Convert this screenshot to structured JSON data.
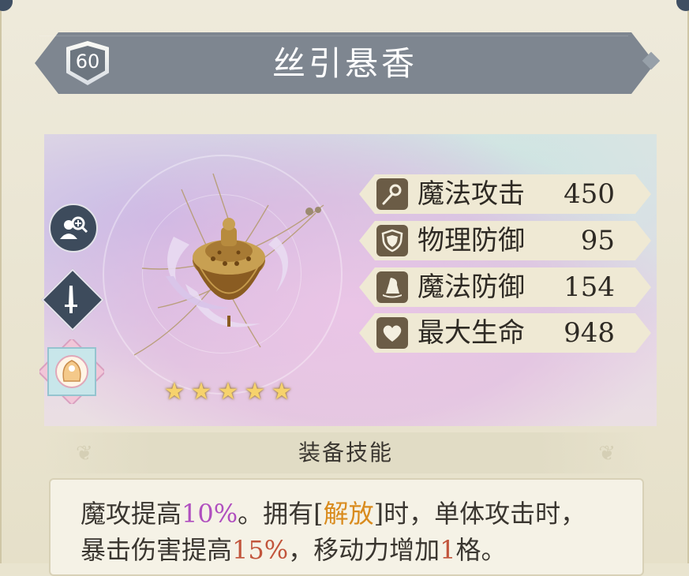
{
  "item": {
    "level": "60",
    "name": "丝引悬香",
    "stars": 5
  },
  "stats": [
    {
      "icon": "staff-icon",
      "label": "魔法攻击",
      "value": "450"
    },
    {
      "icon": "shield-icon",
      "label": "物理防御",
      "value": "95"
    },
    {
      "icon": "wizard-hat-icon",
      "label": "魔法防御",
      "value": "154"
    },
    {
      "icon": "heart-icon",
      "label": "最大生命",
      "value": "948"
    }
  ],
  "skill": {
    "header": "装备技能",
    "line1_a": "魔攻提高",
    "line1_b": "10%",
    "line1_c": "。拥有[",
    "line1_d": "解放",
    "line1_e": "]时，单体攻击时，",
    "line2_a": "暴击伤害提高",
    "line2_b": "15%",
    "line2_c": "，移动力增加",
    "line2_d": "1",
    "line2_e": "格。"
  },
  "colors": {
    "title_bar": "#7e8690",
    "stat_bg": "#efe9d4",
    "highlight_purple": "#b04fbf",
    "highlight_gold": "#d98b1d",
    "highlight_red": "#c2553c",
    "star": "#f6d26c"
  }
}
